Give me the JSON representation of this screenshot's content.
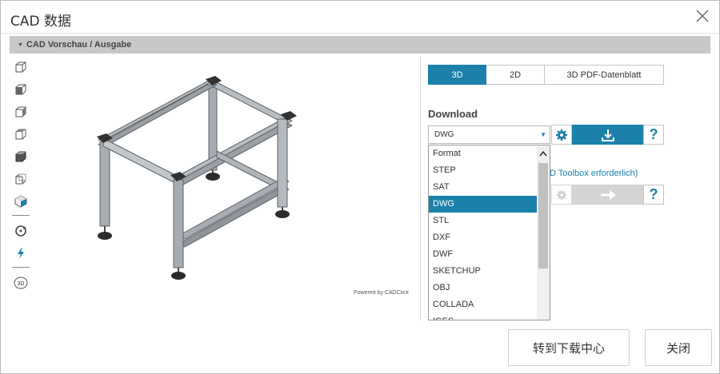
{
  "dialog": {
    "title": "CAD 数据",
    "section_title": "CAD Vorschau / Ausgabe"
  },
  "toolbar": {
    "icons": [
      "view-iso-cube-icon",
      "view-front-cube-icon",
      "view-side-cube-icon",
      "view-top-cube-icon",
      "shaded-cube-icon",
      "wireframe-cube-icon",
      "color-palette-icon",
      "rotate-icon",
      "lightning-icon",
      "view-3d-icon"
    ],
    "view3d_label": "3D"
  },
  "preview": {
    "powered_text": "Powered by CADClick"
  },
  "tabs": [
    {
      "label": "3D",
      "active": true
    },
    {
      "label": "2D",
      "active": false
    },
    {
      "label": "3D PDF-Datenblatt",
      "active": false
    }
  ],
  "download": {
    "label": "Download",
    "selected_format": "DWG",
    "help_label": "?",
    "toolbox_text": "D Toolbox erforderlich)",
    "help2_label": "?"
  },
  "dropdown": {
    "options": [
      "Format",
      "STEP",
      "SAT",
      "DWG",
      "STL",
      "DXF",
      "DWF",
      "SKETCHUP",
      "OBJ",
      "COLLADA",
      "IGES"
    ],
    "selected_index": 3
  },
  "footer": {
    "download_center_label": "转到下载中心",
    "close_label": "关闭"
  },
  "colors": {
    "accent": "#1b81ab",
    "section_bar": "#c8c8c8",
    "disabled_button": "#d4d4d4",
    "frame_grey": "#9aa0a6"
  }
}
